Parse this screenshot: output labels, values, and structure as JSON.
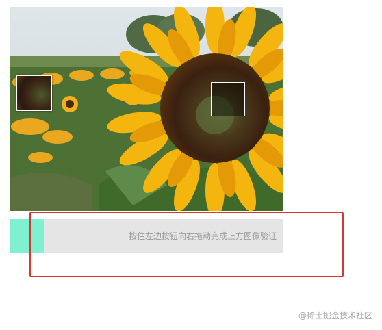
{
  "captcha": {
    "image_subject": "sunflower-field",
    "slider_hint": "按住左边按钮向右拖动完成上方图像验证",
    "colors": {
      "track": "#e5e5e5",
      "handle": "#7ff0d0",
      "hint_text": "#999999",
      "highlight": "#d23a31"
    }
  },
  "watermark": {
    "text": "@稀土掘金技术社区"
  }
}
